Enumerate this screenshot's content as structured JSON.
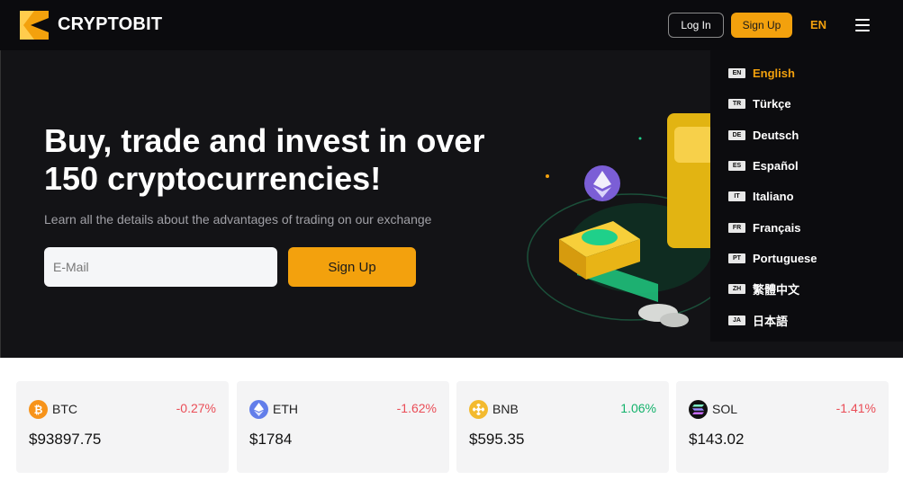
{
  "header": {
    "brand": "CRYPTOBIT",
    "login_label": "Log In",
    "signup_label": "Sign Up",
    "lang_code": "EN",
    "accent_color": "#f3a10d"
  },
  "hero": {
    "title_line1": "Buy, trade and invest in over",
    "title_line2": "150 cryptocurrencies!",
    "subtitle": "Learn all the details about the advantages of trading on our exchange",
    "email_placeholder": "E-Mail",
    "signup_label": "Sign Up"
  },
  "language_menu": {
    "items": [
      {
        "code": "EN",
        "label": "English",
        "active": true
      },
      {
        "code": "TR",
        "label": "Türkçe",
        "active": false
      },
      {
        "code": "DE",
        "label": "Deutsch",
        "active": false
      },
      {
        "code": "ES",
        "label": "Español",
        "active": false
      },
      {
        "code": "IT",
        "label": "Italiano",
        "active": false
      },
      {
        "code": "FR",
        "label": "Français",
        "active": false
      },
      {
        "code": "PT",
        "label": "Portuguese",
        "active": false
      },
      {
        "code": "ZH",
        "label": "繁體中文",
        "active": false
      },
      {
        "code": "JA",
        "label": "日本語",
        "active": false
      }
    ]
  },
  "tickers": [
    {
      "symbol": "BTC",
      "change": "-0.27%",
      "price": "$93897.75",
      "icon": "btc-icon",
      "color": "#f7931a",
      "glyph": "₿"
    },
    {
      "symbol": "ETH",
      "change": "-1.62%",
      "price": "$1784",
      "icon": "eth-icon",
      "color": "#627eea",
      "glyph": "◆"
    },
    {
      "symbol": "BNB",
      "change": "1.06%",
      "price": "$595.35",
      "icon": "bnb-icon",
      "color": "#f3ba2f",
      "glyph": "◈"
    },
    {
      "symbol": "SOL",
      "change": "-1.41%",
      "price": "$143.02",
      "icon": "sol-icon",
      "color": "#111111",
      "glyph": "≡"
    }
  ]
}
